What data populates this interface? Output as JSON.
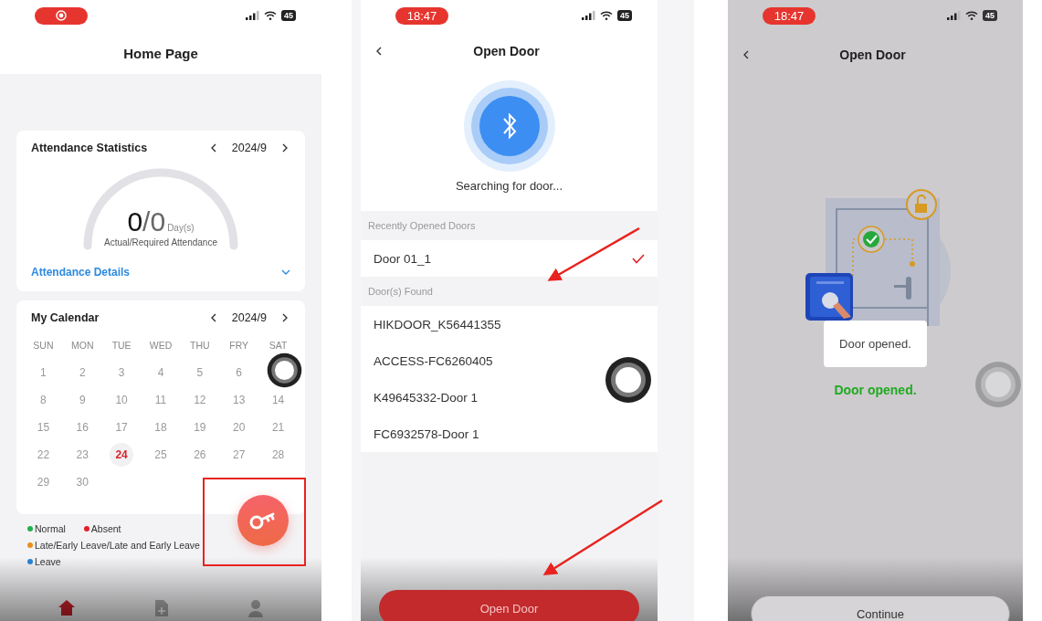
{
  "home_screen": {
    "status_bar": {
      "battery": "45"
    },
    "title": "Home Page",
    "attendance": {
      "title": "Attendance Statistics",
      "period": "2024/9",
      "actual": "0",
      "required": "/0",
      "unit": "Day(s)",
      "caption": "Actual/Required Attendance",
      "details_link": "Attendance Details"
    },
    "calendar": {
      "title": "My Calendar",
      "period": "2024/9",
      "weekdays": [
        "SUN",
        "MON",
        "TUE",
        "WED",
        "THU",
        "FRY",
        "SAT"
      ],
      "days": [
        {
          "kind": "day",
          "day": "1",
          "selected": false
        },
        {
          "kind": "day",
          "day": "2",
          "selected": false
        },
        {
          "kind": "day",
          "day": "3",
          "selected": false
        },
        {
          "kind": "day",
          "day": "4",
          "selected": false
        },
        {
          "kind": "day",
          "day": "5",
          "selected": false
        },
        {
          "kind": "day",
          "day": "6",
          "selected": false
        },
        {
          "kind": "covered"
        },
        {
          "kind": "day",
          "day": "8",
          "selected": false
        },
        {
          "kind": "day",
          "day": "9",
          "selected": false
        },
        {
          "kind": "day",
          "day": "10",
          "selected": false
        },
        {
          "kind": "day",
          "day": "11",
          "selected": false
        },
        {
          "kind": "day",
          "day": "12",
          "selected": false
        },
        {
          "kind": "day",
          "day": "13",
          "selected": false
        },
        {
          "kind": "day",
          "day": "14",
          "selected": false
        },
        {
          "kind": "day",
          "day": "15",
          "selected": false
        },
        {
          "kind": "day",
          "day": "16",
          "selected": false
        },
        {
          "kind": "day",
          "day": "17",
          "selected": false
        },
        {
          "kind": "day",
          "day": "18",
          "selected": false
        },
        {
          "kind": "day",
          "day": "19",
          "selected": false
        },
        {
          "kind": "day",
          "day": "20",
          "selected": false
        },
        {
          "kind": "day",
          "day": "21",
          "selected": false
        },
        {
          "kind": "day",
          "day": "22",
          "selected": false
        },
        {
          "kind": "day",
          "day": "23",
          "selected": false
        },
        {
          "kind": "day",
          "day": "24",
          "selected": true
        },
        {
          "kind": "day",
          "day": "25",
          "selected": false
        },
        {
          "kind": "day",
          "day": "26",
          "selected": false
        },
        {
          "kind": "day",
          "day": "27",
          "selected": false
        },
        {
          "kind": "day",
          "day": "28",
          "selected": false
        },
        {
          "kind": "day",
          "day": "29",
          "selected": false
        },
        {
          "kind": "day",
          "day": "30",
          "selected": false
        }
      ]
    },
    "legend": [
      {
        "label": "Normal",
        "color": "#22b04a"
      },
      {
        "label": "Absent",
        "color": "#e5202a"
      },
      {
        "label": "Late/Early Leave/Late and Early Leave",
        "color": "#e8901c"
      },
      {
        "label": "Leave",
        "color": "#2a86d8"
      }
    ],
    "nav": [
      {
        "kind": "home",
        "selected": true
      },
      {
        "kind": "document-add",
        "selected": false
      },
      {
        "kind": "person",
        "selected": false
      }
    ]
  },
  "search_screen": {
    "status_bar": {
      "time": "18:47",
      "battery": "45"
    },
    "title": "Open Door",
    "searching_text": "Searching for door...",
    "sections": [
      {
        "header": "Recently Opened Doors",
        "doors": [
          {
            "name": "Door 01_1",
            "selected": true
          }
        ]
      },
      {
        "header": "Door(s) Found",
        "doors": [
          {
            "name": "HIKDOOR_K56441355",
            "selected": false
          },
          {
            "name": "ACCESS-FC6260405",
            "selected": false
          },
          {
            "name": "K49645332-Door 1",
            "selected": false
          },
          {
            "name": "FC6932578-Door 1",
            "selected": false
          }
        ]
      }
    ],
    "button": "Open Door"
  },
  "opened_screen": {
    "status_bar": {
      "time": "18:47",
      "battery": "45"
    },
    "title": "Open Door",
    "toast": "Door opened.",
    "status_text": "Door opened.",
    "button": "Continue"
  }
}
